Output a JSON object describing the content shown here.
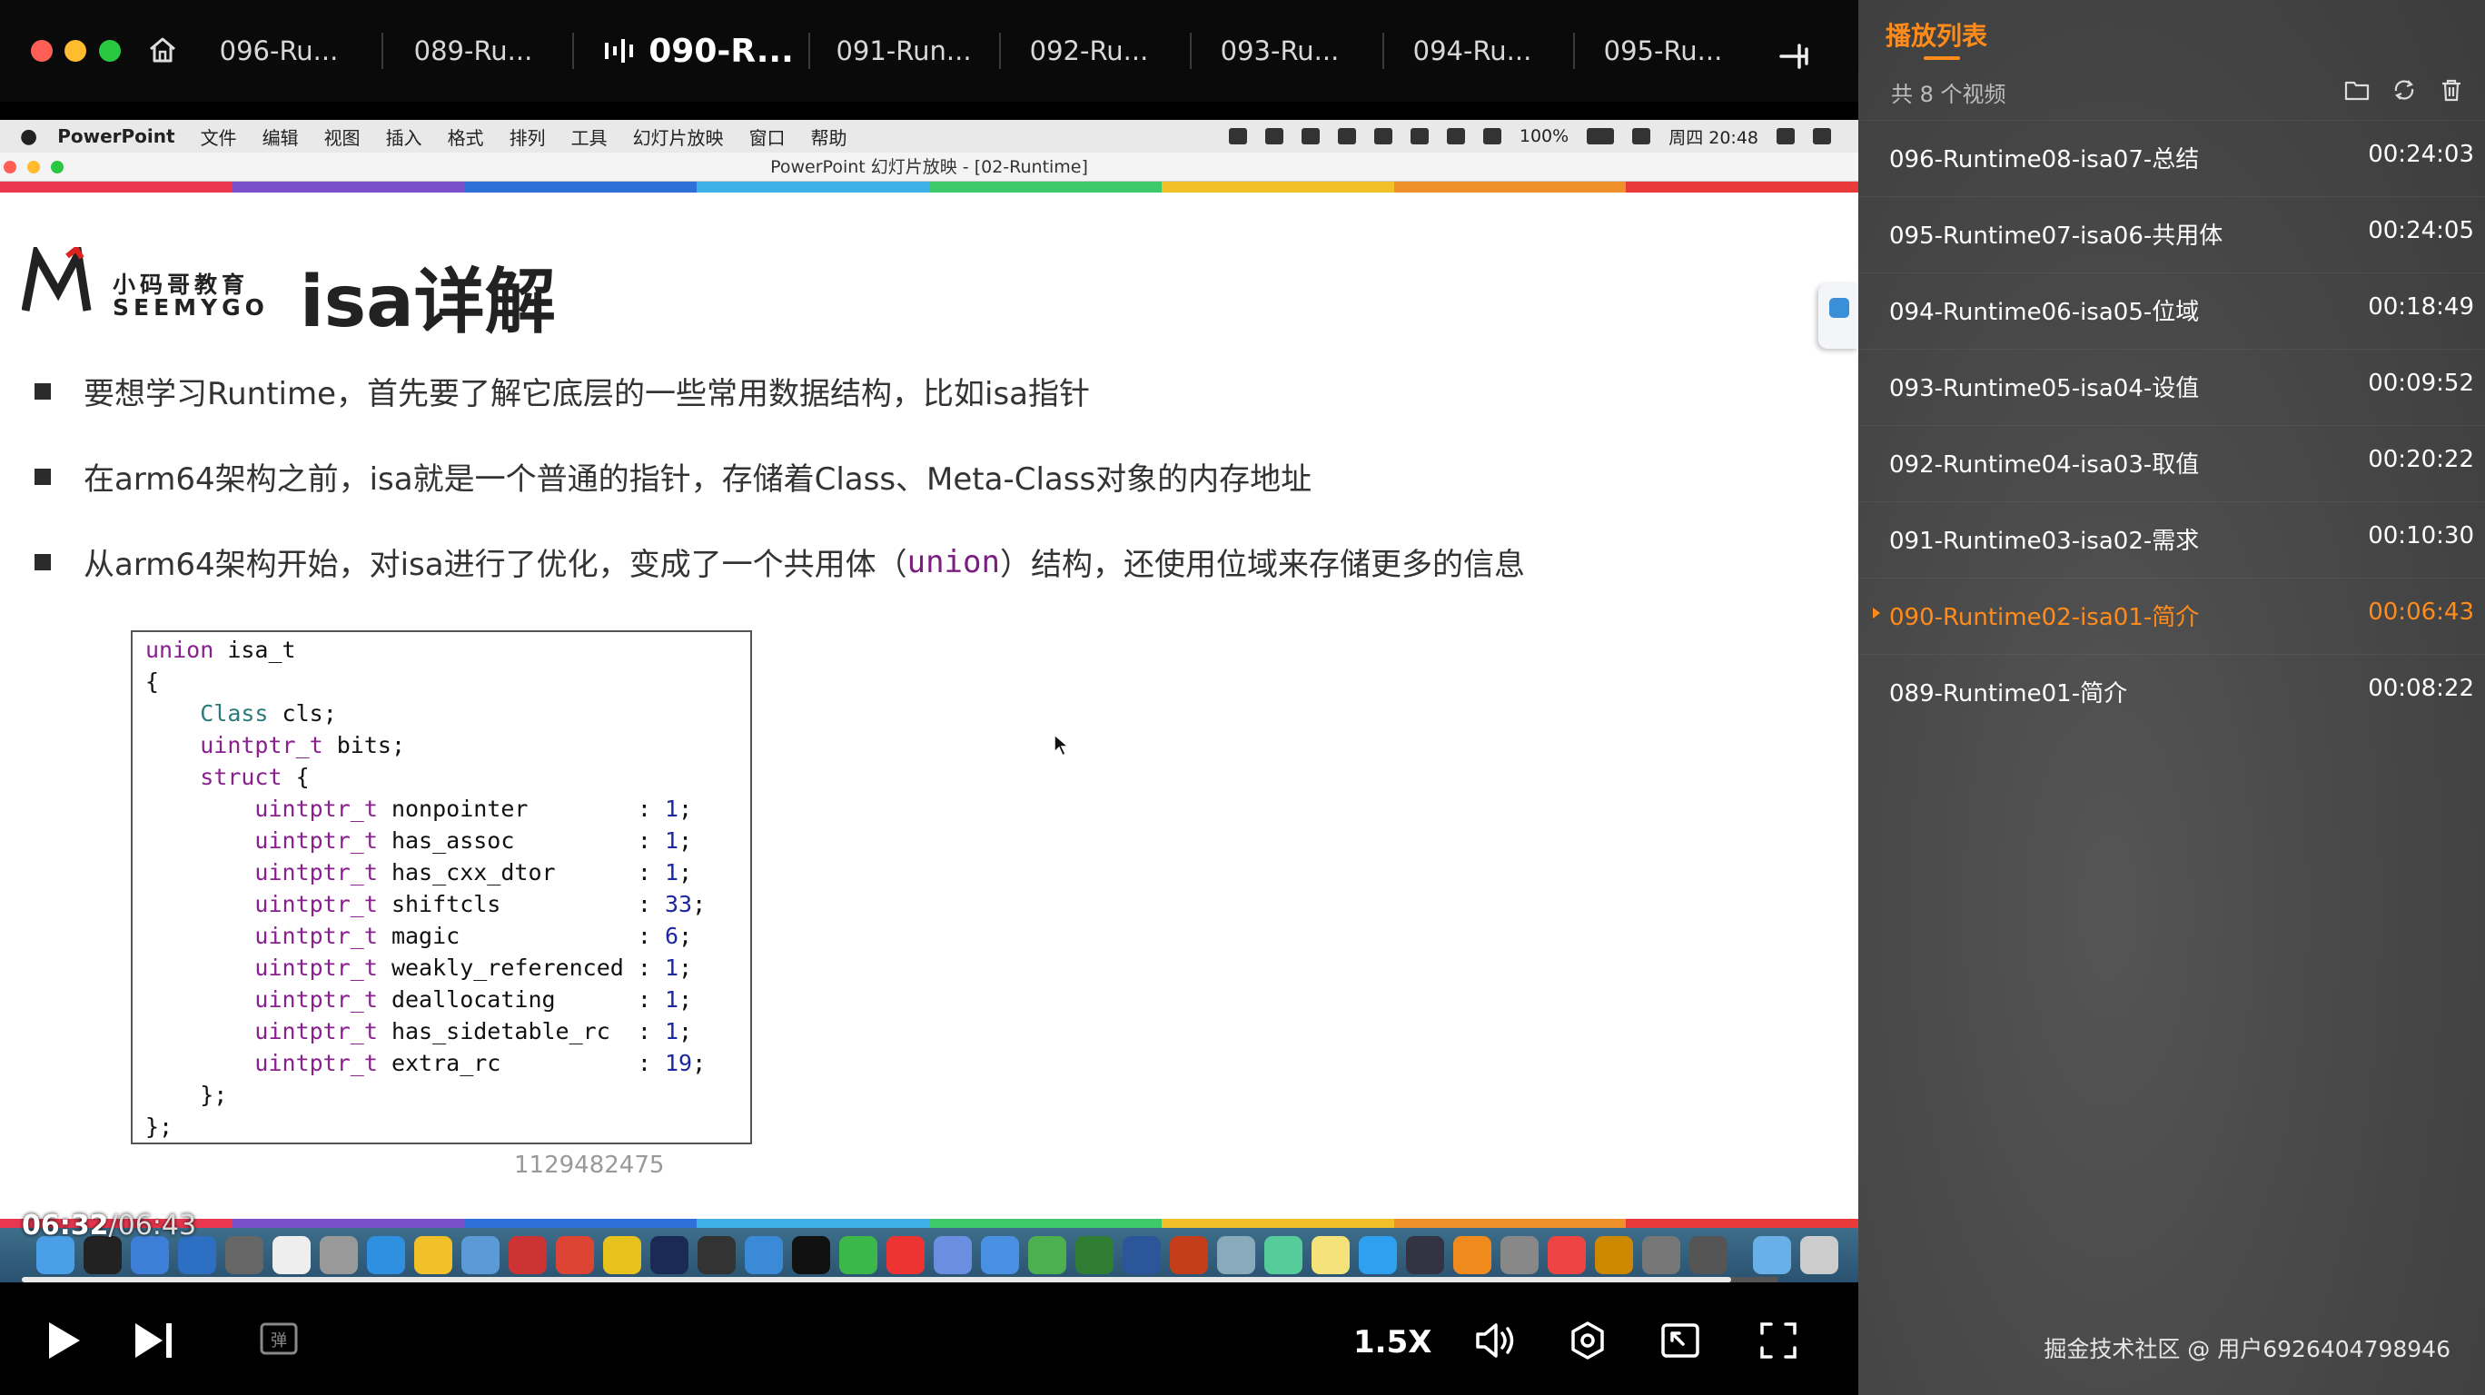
{
  "tabs": [
    {
      "label": "096-Ru..."
    },
    {
      "label": "089-Ru..."
    },
    {
      "label": "090-R..."
    },
    {
      "label": "091-Run..."
    },
    {
      "label": "092-Ru..."
    },
    {
      "label": "093-Ru..."
    },
    {
      "label": "094-Ru..."
    },
    {
      "label": "095-Ru..."
    }
  ],
  "mac_menu": {
    "app": "PowerPoint",
    "items": [
      "文件",
      "编辑",
      "视图",
      "插入",
      "格式",
      "排列",
      "工具",
      "幻灯片放映",
      "窗口",
      "帮助"
    ],
    "battery": "100%",
    "clock": "周四 20:48"
  },
  "window_title": "PowerPoint 幻灯片放映 - [02-Runtime]",
  "slide": {
    "logo_cn": "小码哥教育",
    "logo_en": "SEEMYGO",
    "title": "isa详解",
    "bullets": [
      {
        "text": "要想学习Runtime，首先要了解它底层的一些常用数据结构，比如isa指针"
      },
      {
        "text": "在arm64架构之前，isa就是一个普通的指针，存储着Class、Meta-Class对象的内存地址"
      },
      {
        "pre": "从arm64架构开始，对isa进行了优化，变成了一个共用体（",
        "kw": "union",
        "post": "）结构，还使用位域来存储更多的信息"
      }
    ],
    "code": {
      "union_kw": "union",
      "union_name": " isa_t",
      "open": "{",
      "class_type": "Class",
      "class_name": " cls;",
      "bits_type": "uintptr_t",
      "bits_name": " bits;",
      "struct_kw": "struct",
      "struct_open": " {",
      "fields": [
        {
          "type": "uintptr_t",
          "name": " nonpointer        ",
          "bits": "1"
        },
        {
          "type": "uintptr_t",
          "name": " has_assoc         ",
          "bits": "1"
        },
        {
          "type": "uintptr_t",
          "name": " has_cxx_dtor      ",
          "bits": "1"
        },
        {
          "type": "uintptr_t",
          "name": " shiftcls          ",
          "bits": "33"
        },
        {
          "type": "uintptr_t",
          "name": " magic             ",
          "bits": "6"
        },
        {
          "type": "uintptr_t",
          "name": " weakly_referenced ",
          "bits": "1"
        },
        {
          "type": "uintptr_t",
          "name": " deallocating      ",
          "bits": "1"
        },
        {
          "type": "uintptr_t",
          "name": " has_sidetable_rc  ",
          "bits": "1"
        },
        {
          "type": "uintptr_t",
          "name": " extra_rc          ",
          "bits": "19"
        }
      ],
      "struct_close": "};",
      "close": "};"
    },
    "watermark_id": "1129482475"
  },
  "player": {
    "current_time": "06:32",
    "duration": "/06:43",
    "progress": 0.973,
    "speed": "1.5X"
  },
  "playlist": {
    "title": "播放列表",
    "count": "共 8 个视频",
    "items": [
      {
        "name": "096-Runtime08-isa07-总结",
        "duration": "00:24:03"
      },
      {
        "name": "095-Runtime07-isa06-共用体",
        "duration": "00:24:05"
      },
      {
        "name": "094-Runtime06-isa05-位域",
        "duration": "00:18:49"
      },
      {
        "name": "093-Runtime05-isa04-设值",
        "duration": "00:09:52"
      },
      {
        "name": "092-Runtime04-isa03-取值",
        "duration": "00:20:22"
      },
      {
        "name": "091-Runtime03-isa02-需求",
        "duration": "00:10:30"
      },
      {
        "name": "090-Runtime02-isa01-简介",
        "duration": "00:06:43"
      },
      {
        "name": "089-Runtime01-简介",
        "duration": "00:08:22"
      }
    ],
    "playing_index": 6
  },
  "footer_credit": "掘金技术社区 @ 用户6926404798946",
  "colors": {
    "accent_orange": "#ff8c1a",
    "rainbow": [
      "#e8374f",
      "#7b4fc9",
      "#2e6fd8",
      "#3fb0e8",
      "#3fc96a",
      "#f2c12a",
      "#f0902a",
      "#e83a3a"
    ]
  }
}
